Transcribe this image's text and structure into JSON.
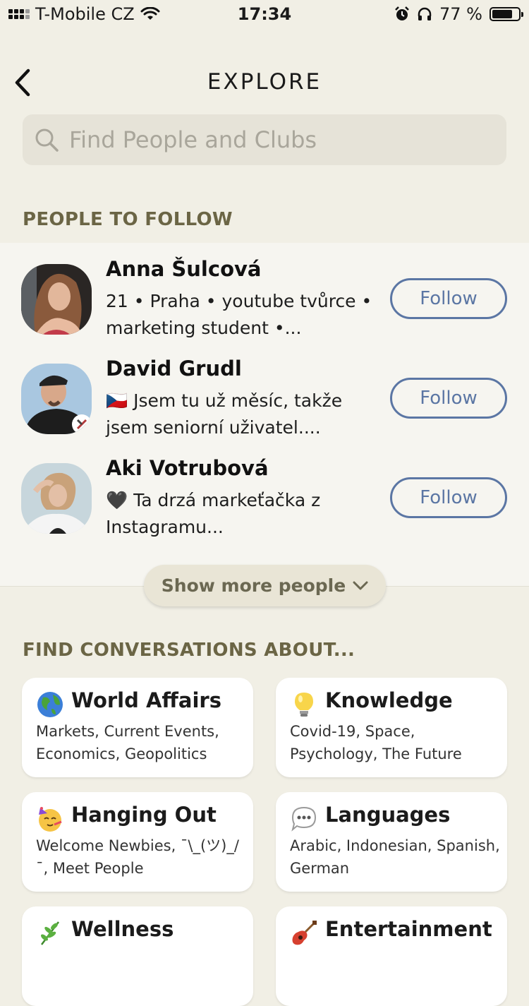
{
  "status_bar": {
    "carrier": "T-Mobile CZ",
    "time": "17:34",
    "battery_percent": "77 %",
    "battery_level": 0.77
  },
  "header": {
    "title": "EXPLORE",
    "search_placeholder": "Find People and Clubs"
  },
  "people_section": {
    "heading": "PEOPLE TO FOLLOW",
    "people": [
      {
        "name": "Anna Šulcová",
        "bio_line1": "21 • Praha • youtube tvůrce •",
        "bio_line2": "marketing student •...",
        "follow_label": "Follow"
      },
      {
        "name": "David Grudl",
        "bio_line1": "🇨🇿 Jsem tu už měsíc, takže",
        "bio_line2": "jsem seniorní uživatel....",
        "follow_label": "Follow"
      },
      {
        "name": "Aki Votrubová",
        "bio_line1": "🖤 Ta drzá markeťačka z",
        "bio_line2": "Instagramu...",
        "follow_label": "Follow"
      }
    ],
    "show_more_label": "Show more people"
  },
  "topics_section": {
    "heading": "FIND CONVERSATIONS ABOUT...",
    "topics": [
      {
        "title": "World Affairs",
        "subtitle": "Markets, Current Events, Economics, Geopolitics",
        "icon": "globe-icon"
      },
      {
        "title": "Knowledge",
        "subtitle": "Covid-19, Space, Psychology, The Future",
        "icon": "lightbulb-icon"
      },
      {
        "title": "Hanging Out",
        "subtitle": "Welcome Newbies, ¯\\_(ツ)_/¯, Meet People",
        "icon": "party-face-icon"
      },
      {
        "title": "Languages",
        "subtitle": "Arabic, Indonesian, Spanish, German",
        "icon": "speech-bubble-icon"
      },
      {
        "title": "Wellness",
        "subtitle": "",
        "icon": "herb-icon"
      },
      {
        "title": "Entertainment",
        "subtitle": "",
        "icon": "guitar-icon"
      }
    ]
  },
  "colors": {
    "background": "#f1efe5",
    "accent_blue": "#5b76a4",
    "section_heading": "#6b6545"
  }
}
